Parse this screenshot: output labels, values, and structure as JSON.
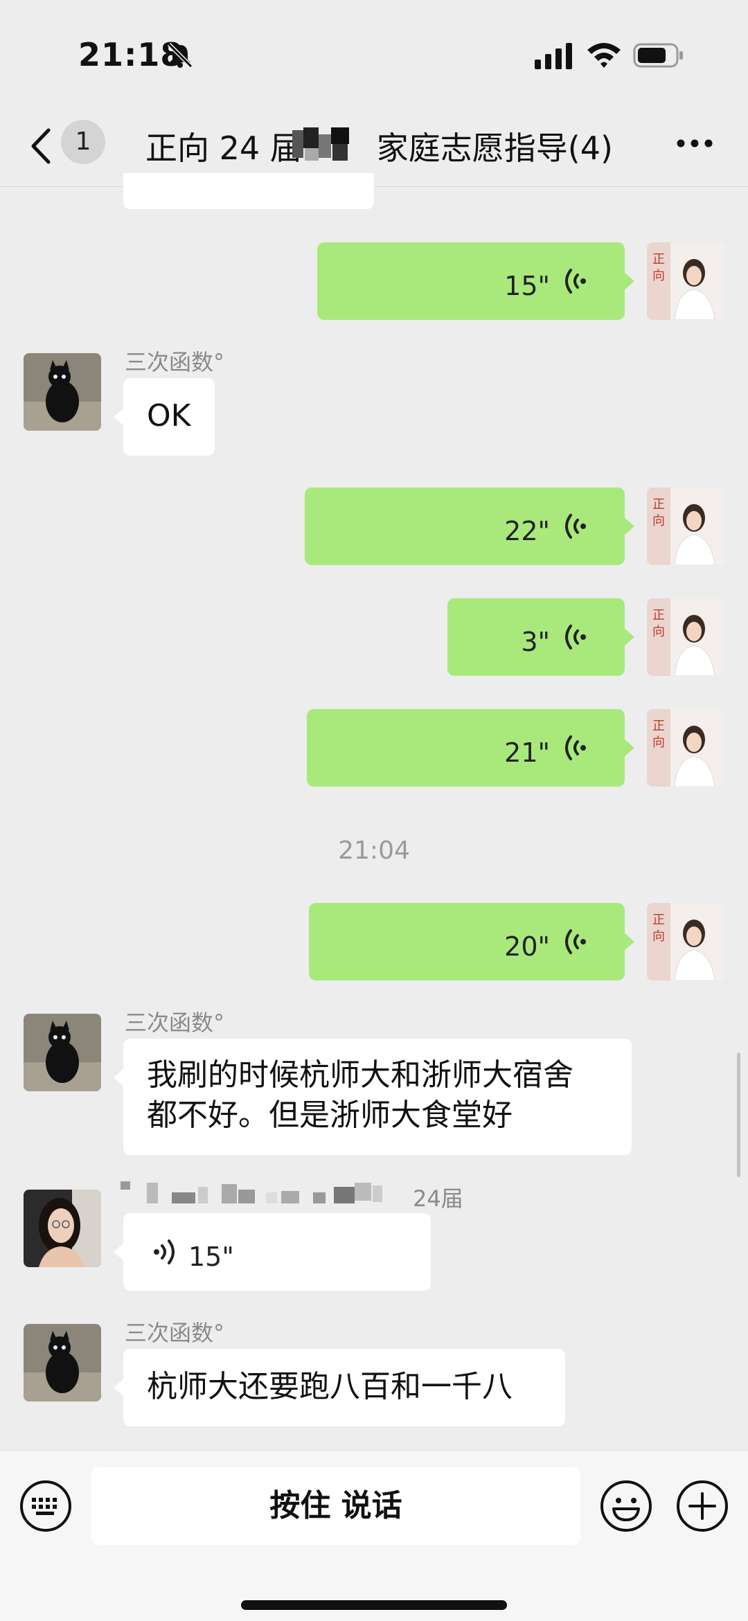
{
  "status_bar": {
    "time": "21:18",
    "icons": [
      "bell-muted-icon",
      "signal-icon",
      "wifi-icon",
      "battery-icon"
    ]
  },
  "nav": {
    "back_icon": "chevron-left-icon",
    "unread_count": "1",
    "title_prefix": "正向 24 届",
    "title_suffix": "家庭志愿指导(4)",
    "more_icon": "more-dots-icon"
  },
  "messages": {
    "partial_top": "",
    "voice_1": {
      "duration": "15\""
    },
    "msg_ok": {
      "sender": "三次函数°",
      "text": "OK"
    },
    "voice_2": {
      "duration": "22\""
    },
    "voice_3": {
      "duration": "3\""
    },
    "voice_4": {
      "duration": "21\""
    },
    "timestamp": "21:04",
    "voice_5": {
      "duration": "20\""
    },
    "msg_dorm": {
      "sender": "三次函数°",
      "line1": "我刷的时候杭师大和浙师大宿舍",
      "line2": "都不好。但是浙师大食堂好"
    },
    "voice_6": {
      "sender_suffix": "24届",
      "duration": "15\""
    },
    "msg_run": {
      "sender": "三次函数°",
      "text": "杭师大还要跑八百和一千八"
    }
  },
  "input_bar": {
    "hold_to_talk": "按住 说话",
    "icons": [
      "keyboard-icon",
      "emoji-icon",
      "plus-icon"
    ]
  },
  "colors": {
    "background": "#ededed",
    "self_bubble": "#a9e97c",
    "other_bubble": "#ffffff"
  }
}
